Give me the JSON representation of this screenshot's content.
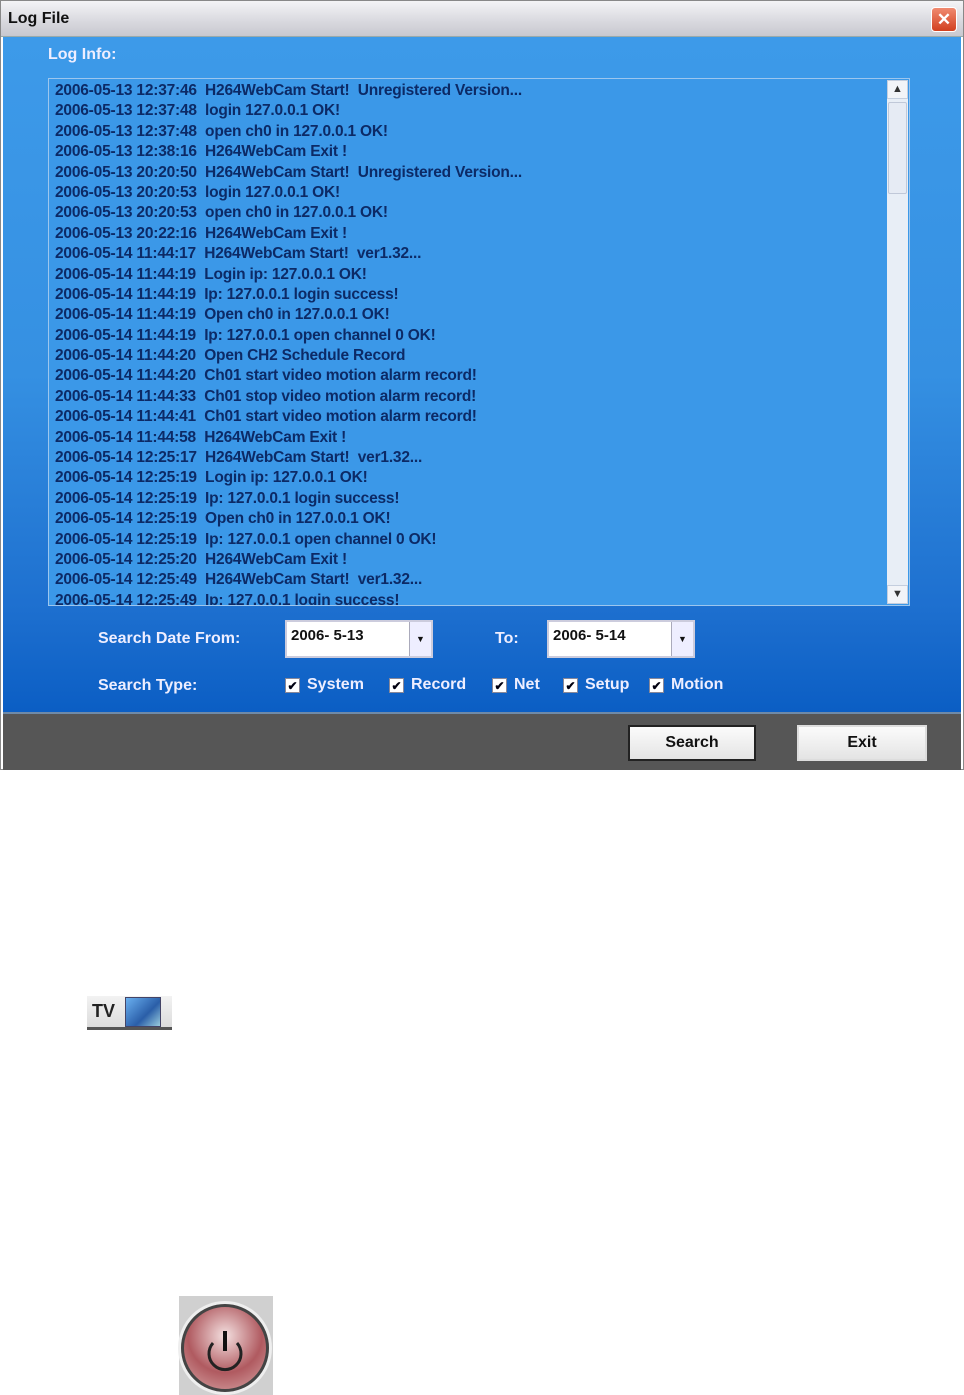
{
  "window": {
    "title": "Log File",
    "close_icon": "close-icon"
  },
  "log": {
    "label": "Log Info:",
    "lines": [
      "2006-05-13 12:37:46  H264WebCam Start!  Unregistered Version...",
      "2006-05-13 12:37:48  login 127.0.0.1 OK!",
      "2006-05-13 12:37:48  open ch0 in 127.0.0.1 OK!",
      "2006-05-13 12:38:16  H264WebCam Exit !",
      "2006-05-13 20:20:50  H264WebCam Start!  Unregistered Version...",
      "2006-05-13 20:20:53  login 127.0.0.1 OK!",
      "2006-05-13 20:20:53  open ch0 in 127.0.0.1 OK!",
      "2006-05-13 20:22:16  H264WebCam Exit !",
      "2006-05-14 11:44:17  H264WebCam Start!  ver1.32...",
      "2006-05-14 11:44:19  Login ip: 127.0.0.1 OK!",
      "2006-05-14 11:44:19  Ip: 127.0.0.1 login success!",
      "2006-05-14 11:44:19  Open ch0 in 127.0.0.1 OK!",
      "2006-05-14 11:44:19  Ip: 127.0.0.1 open channel 0 OK!",
      "2006-05-14 11:44:20  Open CH2 Schedule Record",
      "2006-05-14 11:44:20  Ch01 start video motion alarm record!",
      "2006-05-14 11:44:33  Ch01 stop video motion alarm record!",
      "2006-05-14 11:44:41  Ch01 start video motion alarm record!",
      "2006-05-14 11:44:58  H264WebCam Exit !",
      "2006-05-14 12:25:17  H264WebCam Start!  ver1.32...",
      "2006-05-14 12:25:19  Login ip: 127.0.0.1 OK!",
      "2006-05-14 12:25:19  Ip: 127.0.0.1 login success!",
      "2006-05-14 12:25:19  Open ch0 in 127.0.0.1 OK!",
      "2006-05-14 12:25:19  Ip: 127.0.0.1 open channel 0 OK!",
      "2006-05-14 12:25:20  H264WebCam Exit !",
      "2006-05-14 12:25:49  H264WebCam Start!  ver1.32...",
      "2006-05-14 12:25:49  Ip: 127.0.0.1 login success!"
    ]
  },
  "search": {
    "date_from_label": "Search Date From:",
    "date_from": "2006- 5-13",
    "to_label": "To:",
    "date_to": "2006- 5-14",
    "type_label": "Search Type:",
    "types": [
      {
        "label": "System",
        "checked": true
      },
      {
        "label": "Record",
        "checked": true
      },
      {
        "label": "Net",
        "checked": true
      },
      {
        "label": "Setup",
        "checked": true
      },
      {
        "label": "Motion",
        "checked": true
      }
    ]
  },
  "buttons": {
    "search": "Search",
    "exit": "Exit"
  },
  "extras": {
    "tv_label": "TV",
    "power_icon": "power-icon"
  }
}
